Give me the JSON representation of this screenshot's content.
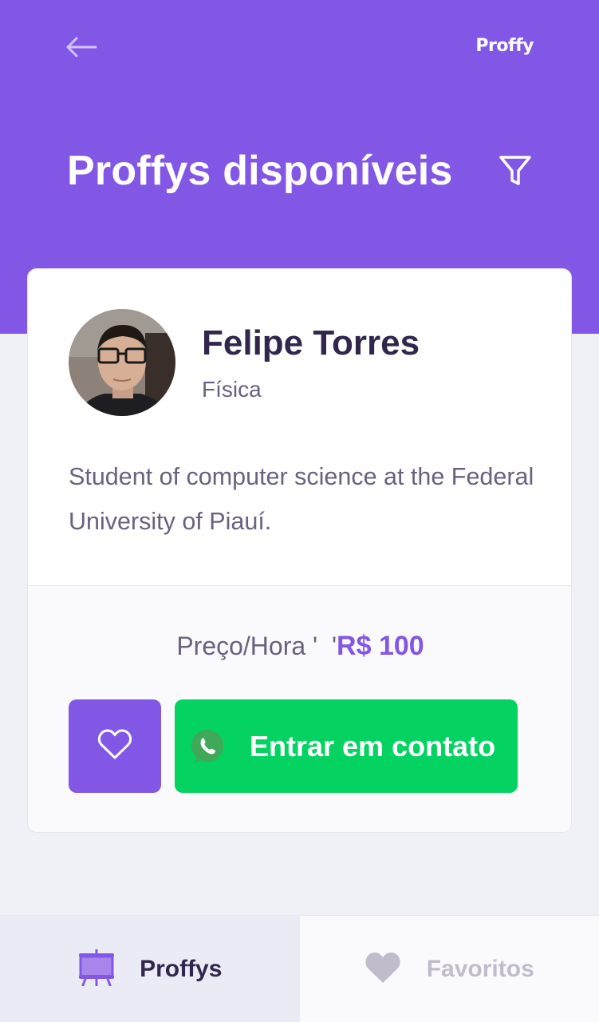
{
  "header": {
    "logo": "Proffy",
    "title": "Proffys disponíveis",
    "back_icon": "arrow-left-icon",
    "filter_icon": "filter-icon",
    "color": "#8257E5"
  },
  "teacher_card": {
    "name": "Felipe Torres",
    "subject": "Física",
    "bio": "Student of computer science at the Federal University of Piauí.",
    "price_label": "Preço/Hora '  '",
    "price_value": "R$ 100",
    "favorite_icon": "heart-outline-icon",
    "contact_label": "Entrar em contato",
    "contact_icon": "whatsapp-icon",
    "favorite_button_color": "#8257E5",
    "contact_button_color": "#04D361"
  },
  "tabs": [
    {
      "label": "Proffys",
      "icon": "easel-icon",
      "active": true
    },
    {
      "label": "Favoritos",
      "icon": "heart-icon",
      "active": false
    }
  ]
}
